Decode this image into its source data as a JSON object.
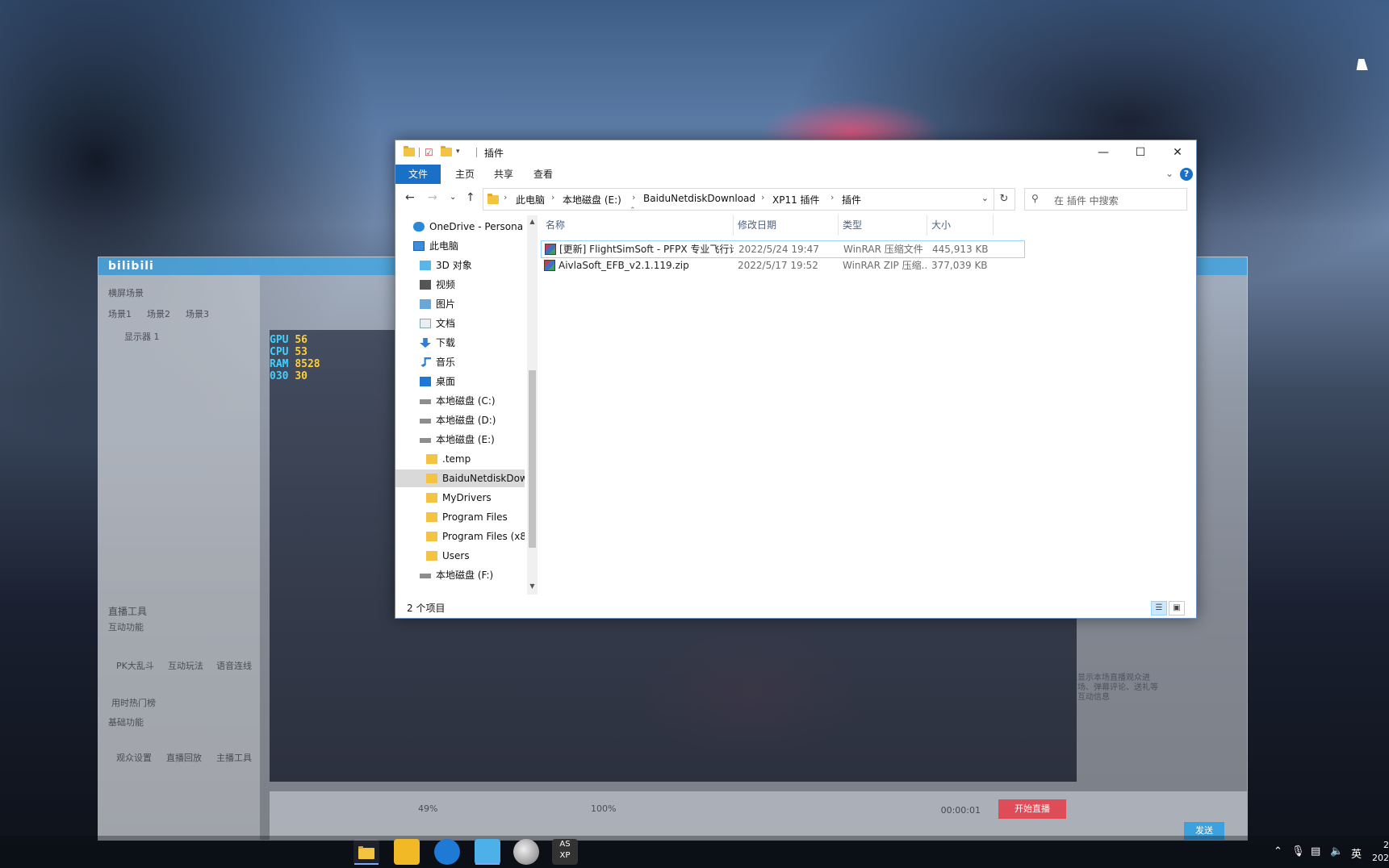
{
  "explorer": {
    "title": "插件",
    "ribbon_tabs": [
      "文件",
      "主页",
      "共享",
      "查看"
    ],
    "help_label": "?",
    "breadcrumb": [
      "此电脑",
      "本地磁盘 (E:)",
      "BaiduNetdiskDownload",
      "XP11 插件",
      "插件"
    ],
    "search_placeholder": "在 插件 中搜索",
    "tree": [
      {
        "label": "OneDrive - Persona",
        "icon": "cloud-icon",
        "level": 0
      },
      {
        "label": "此电脑",
        "icon": "computer-icon",
        "level": 0
      },
      {
        "label": "3D 对象",
        "icon": "cube-icon",
        "level": 1
      },
      {
        "label": "视频",
        "icon": "video-icon",
        "level": 1
      },
      {
        "label": "图片",
        "icon": "picture-icon",
        "level": 1
      },
      {
        "label": "文档",
        "icon": "document-icon",
        "level": 1
      },
      {
        "label": "下载",
        "icon": "download-icon",
        "level": 1
      },
      {
        "label": "音乐",
        "icon": "music-icon",
        "level": 1
      },
      {
        "label": "桌面",
        "icon": "desktop-icon",
        "level": 1
      },
      {
        "label": "本地磁盘 (C:)",
        "icon": "drive-icon",
        "level": 1
      },
      {
        "label": "本地磁盘 (D:)",
        "icon": "drive-icon",
        "level": 1
      },
      {
        "label": "本地磁盘 (E:)",
        "icon": "drive-icon",
        "level": 1
      },
      {
        "label": ".temp",
        "icon": "folder-icon",
        "level": 2
      },
      {
        "label": "BaiduNetdiskDow",
        "icon": "folder-icon",
        "level": 2,
        "selected": true
      },
      {
        "label": "MyDrivers",
        "icon": "folder-icon",
        "level": 2
      },
      {
        "label": "Program Files",
        "icon": "folder-icon",
        "level": 2
      },
      {
        "label": "Program Files (x8",
        "icon": "folder-icon",
        "level": 2
      },
      {
        "label": "Users",
        "icon": "folder-icon",
        "level": 2
      },
      {
        "label": "本地磁盘 (F:)",
        "icon": "drive-icon",
        "level": 1
      }
    ],
    "columns": [
      "名称",
      "修改日期",
      "类型",
      "大小"
    ],
    "files": [
      {
        "name": "[更新] FlightSimSoft - PFPX 专业飞行计...",
        "date": "2022/5/24 19:47",
        "type": "WinRAR 压缩文件",
        "size": "445,913 KB"
      },
      {
        "name": "AivlaSoft_EFB_v2.1.119.zip",
        "date": "2022/5/17 19:52",
        "type": "WinRAR ZIP 压缩...",
        "size": "377,039 KB"
      }
    ],
    "status": "2 个项目"
  },
  "ghost_app": {
    "logo": "bilibili",
    "left_items": [
      "横屏场景",
      "场景1",
      "场景2",
      "场景3",
      "显示器 1"
    ],
    "tools_title": "直播工具",
    "tools": [
      "互动功能",
      "PK大乱斗",
      "互动玩法",
      "语音连线",
      "用时热门榜",
      "基础功能",
      "观众设置",
      "直播回放",
      "主播工具"
    ],
    "stats": {
      "gpu": "56",
      "cpu": "53",
      "ram": "8528",
      "fps": "30"
    },
    "stat_labels": {
      "gpu": "GPU",
      "cpu": "CPU",
      "ram": "RAM",
      "fps": "030"
    },
    "volume_percent": "49%",
    "mic_percent": "100%",
    "timer": "00:00:01",
    "record_label": "开始直播",
    "send_label": "发送",
    "hint": "显示本场直播观众进场、弹幕评论、送礼等互动信息"
  },
  "taskbar": {
    "tray_language": "英",
    "clock_time": "2",
    "clock_date": "202"
  }
}
